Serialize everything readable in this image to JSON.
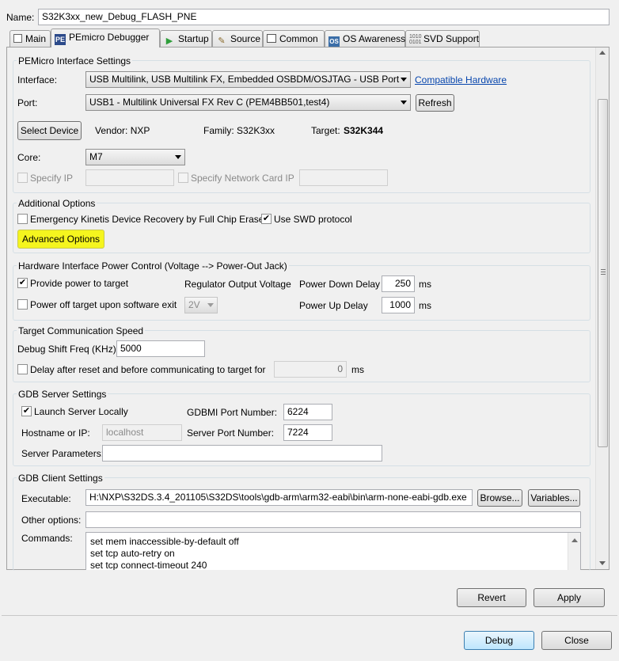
{
  "name": {
    "label": "Name:",
    "value": "S32K3xx_new_Debug_FLASH_PNE"
  },
  "tabs": [
    {
      "label": "Main",
      "icon": "main-tab-icon"
    },
    {
      "label": "PEmicro Debugger",
      "icon": "pemicro-icon"
    },
    {
      "label": "Startup",
      "icon": "play-icon"
    },
    {
      "label": "Source",
      "icon": "source-icon"
    },
    {
      "label": "Common",
      "icon": "common-icon"
    },
    {
      "label": "OS Awareness",
      "icon": "os-icon"
    },
    {
      "label": "SVD Support",
      "icon": "binary-icon"
    }
  ],
  "interface_settings": {
    "title": "PEMicro Interface Settings",
    "interface_label": "Interface:",
    "interface_value": "USB Multilink, USB Multilink FX, Embedded OSBDM/OSJTAG - USB Port",
    "compatible_link": "Compatible Hardware",
    "port_label": "Port:",
    "port_value": "USB1 - Multilink Universal FX Rev C (PEM4BB501,test4)",
    "refresh_label": "Refresh",
    "select_device_label": "Select Device",
    "vendor": "Vendor:  NXP",
    "family": "Family:  S32K3xx",
    "target_label": "Target:",
    "target_value": "S32K344",
    "core_label": "Core:",
    "core_value": "M7",
    "specify_ip_label": "Specify IP",
    "specify_network_label": "Specify Network Card IP"
  },
  "additional_options": {
    "title": "Additional Options",
    "emergency_label": "Emergency Kinetis Device Recovery by Full Chip Erase",
    "swd_label": "Use SWD protocol",
    "advanced_label": "Advanced Options"
  },
  "power_control": {
    "title": "Hardware Interface Power Control (Voltage --> Power-Out Jack)",
    "provide_power_label": "Provide power to target",
    "power_off_label": "Power off target upon software exit",
    "regulator_label": "Regulator Output Voltage",
    "regulator_value": "2V",
    "power_down_label": "Power Down Delay",
    "power_down_value": "250",
    "power_up_label": "Power Up Delay",
    "power_up_value": "1000",
    "ms": "ms"
  },
  "comm_speed": {
    "title": "Target Communication Speed",
    "freq_label": "Debug Shift Freq (KHz)",
    "freq_value": "5000",
    "delay_label": "Delay after reset and before communicating to target for",
    "delay_value": "0",
    "ms": "ms"
  },
  "gdb_server": {
    "title": "GDB Server Settings",
    "launch_label": "Launch Server Locally",
    "gdbmi_label": "GDBMI Port Number:",
    "gdbmi_value": "6224",
    "hostname_label": "Hostname or IP:",
    "hostname_value": "localhost",
    "server_port_label": "Server Port Number:",
    "server_port_value": "7224",
    "params_label": "Server Parameters:",
    "params_value": ""
  },
  "gdb_client": {
    "title": "GDB Client Settings",
    "exec_label": "Executable:",
    "exec_value": "H:\\NXP\\S32DS.3.4_201105\\S32DS\\tools\\gdb-arm\\arm32-eabi\\bin\\arm-none-eabi-gdb.exe",
    "browse_label": "Browse...",
    "variables_label": "Variables...",
    "other_label": "Other options:",
    "other_value": "",
    "commands_label": "Commands:",
    "commands": [
      "set mem inaccessible-by-default off",
      "set tcp auto-retry on",
      "set tcp connect-timeout 240"
    ]
  },
  "buttons": {
    "revert": "Revert",
    "apply": "Apply",
    "debug": "Debug",
    "close": "Close"
  },
  "colors": {
    "highlight": "#f5f51e",
    "link": "#0645ad",
    "default_button_border": "#3c7fb1"
  }
}
